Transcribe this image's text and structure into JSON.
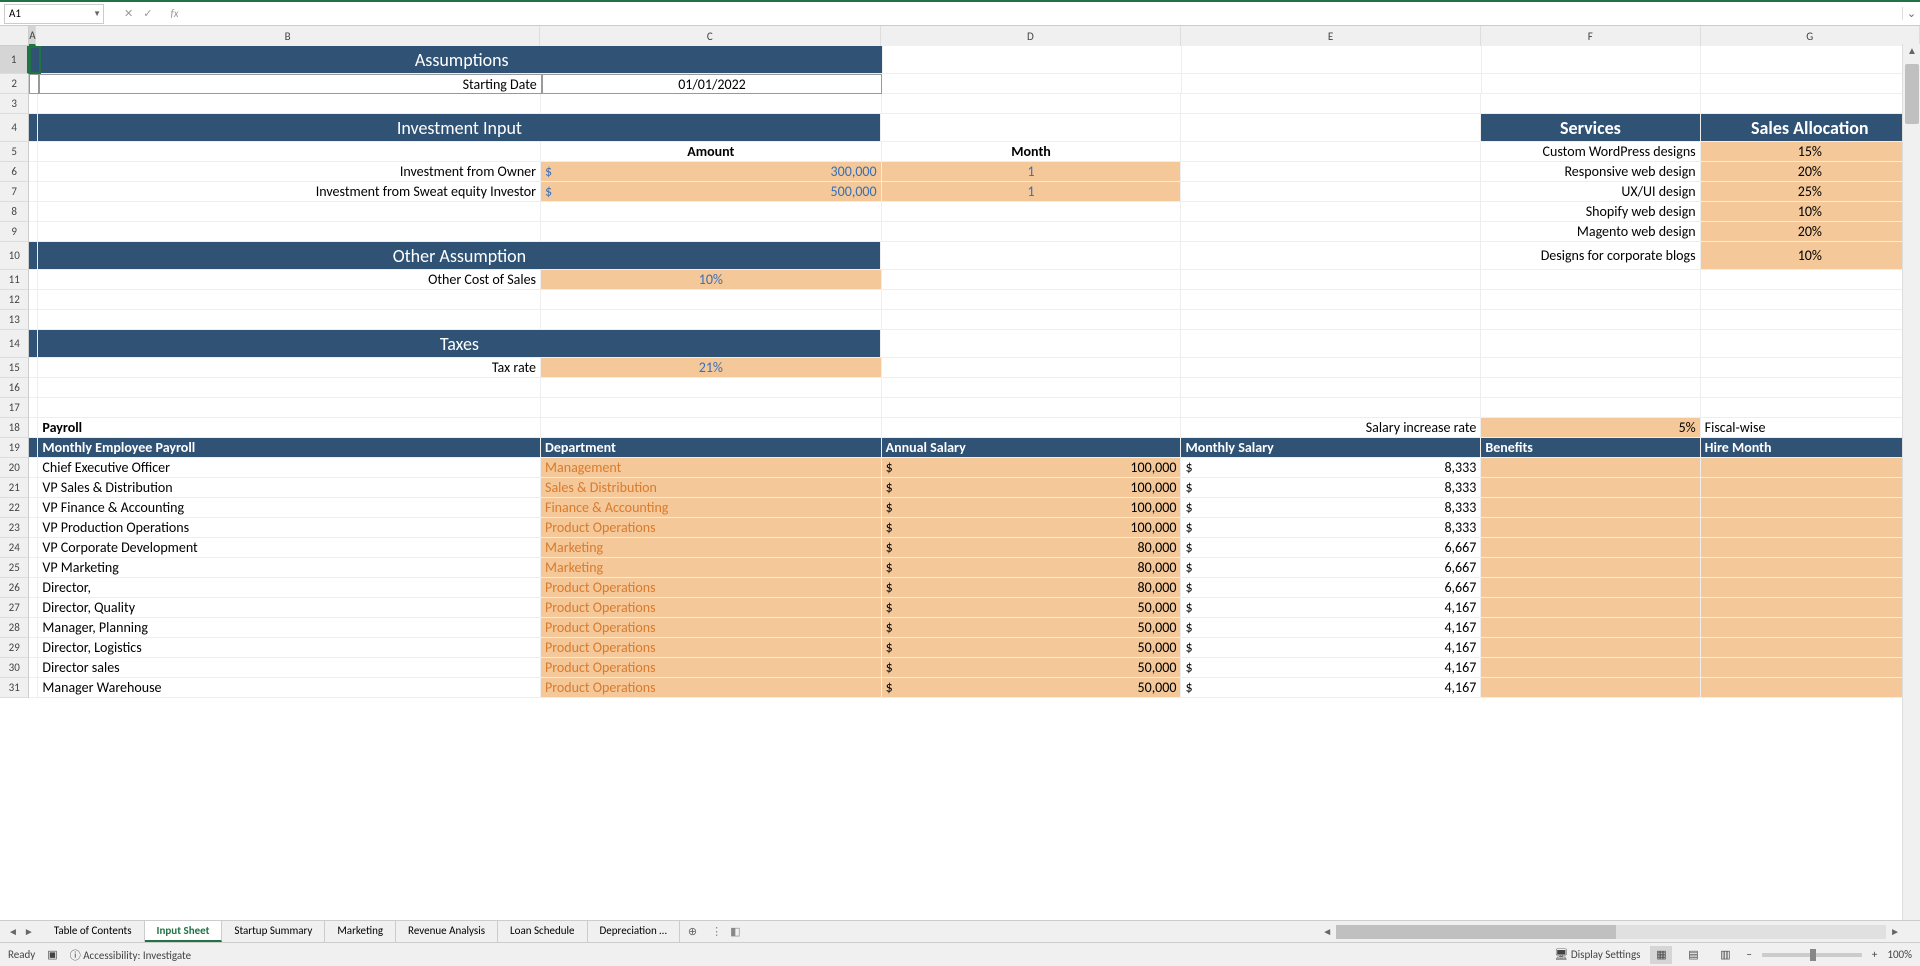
{
  "nameBox": "A1",
  "columns": [
    "A",
    "B",
    "C",
    "D",
    "E",
    "F",
    "G"
  ],
  "rowStart": 1,
  "rowEnd": 31,
  "assumptions": {
    "title": "Assumptions",
    "startingDateLabel": "Starting Date",
    "startingDate": "01/01/2022"
  },
  "investment": {
    "title": "Investment Input",
    "amountLabel": "Amount",
    "monthLabel": "Month",
    "rows": [
      {
        "label": "Investment from Owner",
        "currency": "$",
        "amount": "300,000",
        "month": "1"
      },
      {
        "label": "Investment from Sweat equity Investor",
        "currency": "$",
        "amount": "500,000",
        "month": "1"
      }
    ]
  },
  "otherAssumption": {
    "title": "Other Assumption",
    "label": "Other Cost of Sales",
    "value": "10%"
  },
  "taxes": {
    "title": "Taxes",
    "label": "Tax rate",
    "value": "21%"
  },
  "services": {
    "header1": "Services",
    "header2": "Sales Allocation",
    "rows": [
      {
        "name": "Custom WordPress designs",
        "pct": "15%"
      },
      {
        "name": "Responsive web design",
        "pct": "20%"
      },
      {
        "name": "UX/UI design",
        "pct": "25%"
      },
      {
        "name": "Shopify web design",
        "pct": "10%"
      },
      {
        "name": "Magento web design",
        "pct": "20%"
      },
      {
        "name": "Designs for corporate blogs",
        "pct": "10%"
      }
    ]
  },
  "payroll": {
    "title": "Payroll",
    "salaryIncreaseLabel": "Salary increase rate",
    "salaryIncreaseValue": "5%",
    "fiscalWise": "Fiscal-wise",
    "headers": {
      "position": "Monthly Employee Payroll",
      "department": "Department",
      "annual": "Annual Salary",
      "monthly": "Monthly Salary",
      "benefits": "Benefits",
      "hire": "Hire Month"
    },
    "rows": [
      {
        "position": "Chief Executive Officer",
        "dept": "Management",
        "annual": "100,000",
        "monthly": "8,333"
      },
      {
        "position": "VP Sales & Distribution",
        "dept": "Sales & Distribution",
        "annual": "100,000",
        "monthly": "8,333"
      },
      {
        "position": "VP Finance & Accounting",
        "dept": "Finance & Accounting",
        "annual": "100,000",
        "monthly": "8,333"
      },
      {
        "position": "VP Production Operations",
        "dept": "Product Operations",
        "annual": "100,000",
        "monthly": "8,333"
      },
      {
        "position": "VP Corporate Development",
        "dept": "Marketing",
        "annual": "80,000",
        "monthly": "6,667"
      },
      {
        "position": "VP Marketing",
        "dept": "Marketing",
        "annual": "80,000",
        "monthly": "6,667"
      },
      {
        "position": "Director,",
        "dept": "Product Operations",
        "annual": "80,000",
        "monthly": "6,667"
      },
      {
        "position": "Director, Quality",
        "dept": "Product Operations",
        "annual": "50,000",
        "monthly": "4,167"
      },
      {
        "position": "Manager, Planning",
        "dept": "Product Operations",
        "annual": "50,000",
        "monthly": "4,167"
      },
      {
        "position": "Director, Logistics",
        "dept": "Product Operations",
        "annual": "50,000",
        "monthly": "4,167"
      },
      {
        "position": "Director sales",
        "dept": "Product Operations",
        "annual": "50,000",
        "monthly": "4,167"
      },
      {
        "position": "Manager Warehouse",
        "dept": "Product Operations",
        "annual": "50,000",
        "monthly": "4,167"
      }
    ]
  },
  "tabs": [
    "Table of Contents",
    "Input Sheet",
    "Startup Summary",
    "Marketing",
    "Revenue Analysis",
    "Loan Schedule",
    "Depreciation …"
  ],
  "activeTab": "Input Sheet",
  "status": {
    "ready": "Ready",
    "accessibility": "Accessibility: Investigate",
    "display": "Display Settings",
    "zoom": "100%"
  }
}
